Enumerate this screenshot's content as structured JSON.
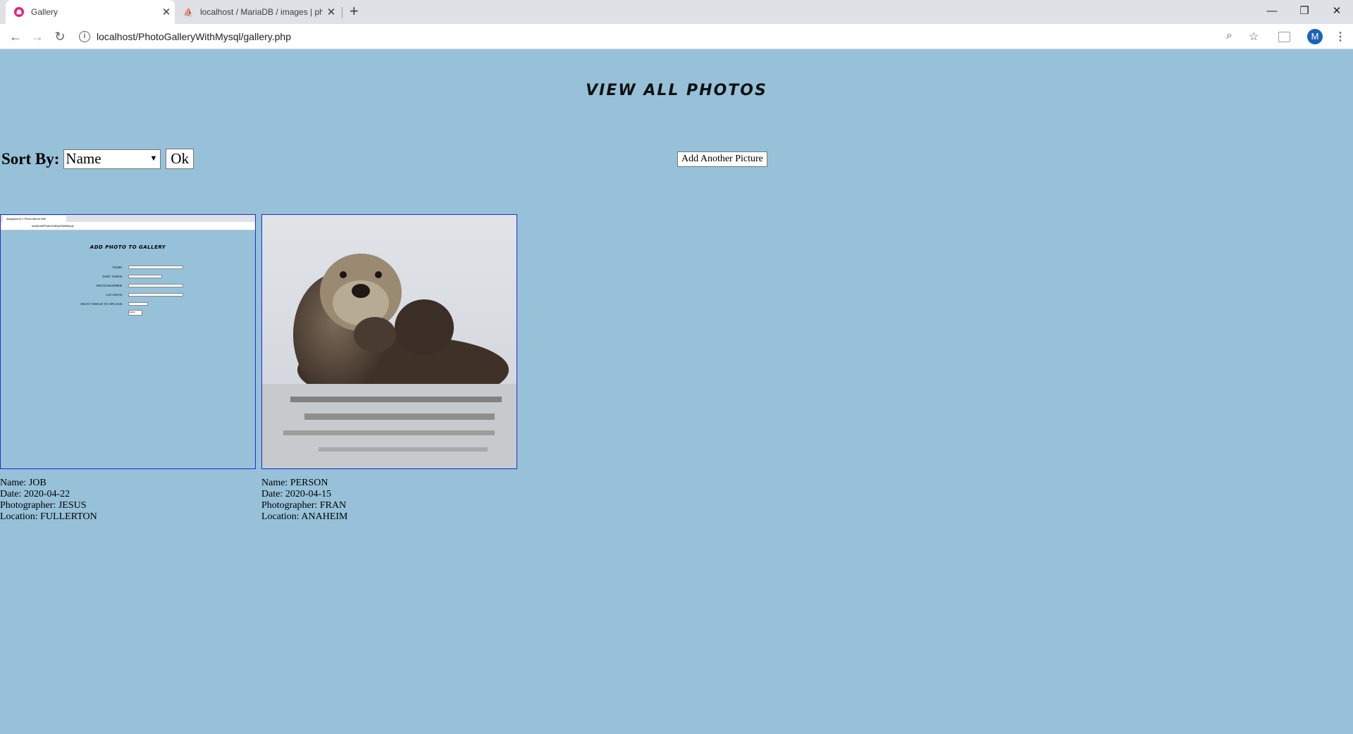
{
  "browser": {
    "tabs": [
      {
        "title": "Gallery",
        "favicon": "pwa-icon",
        "active": true
      },
      {
        "title": "localhost / MariaDB / images | ph",
        "favicon": "phpmyadmin-icon",
        "active": false
      }
    ],
    "url": "localhost/PhotoGalleryWithMysql/gallery.php",
    "profile_initial": "M"
  },
  "page": {
    "title": "View all photos",
    "sort": {
      "label": "Sort By:",
      "selected": "Name",
      "ok_label": "Ok"
    },
    "add_button_label": "Add Another Picture"
  },
  "photos": [
    {
      "image": "screenshot-thumbnail",
      "name": "Name: JOB",
      "date": "Date: 2020-04-22",
      "photographer": "Photographer: JESUS",
      "location": "Location: FULLERTON",
      "thumb": {
        "tab_title": "Assignment 1 Photo Album Wel",
        "url": "localhost/PhotoGalleryWithMysql/",
        "title": "Add Photo to Gallery",
        "fields": [
          "Name:",
          "Date Taken:",
          "Photographer:",
          "Location:",
          "Select image to upload:"
        ],
        "submit": "Submit"
      }
    },
    {
      "image": "sea-otter-photo",
      "name": "Name: PERSON",
      "date": "Date: 2020-04-15",
      "photographer": "Photographer: FRAN",
      "location": "Location: ANAHEIM"
    }
  ],
  "colors": {
    "page_background": "#96c1d8",
    "thumb_border": "#1a2fd6"
  }
}
